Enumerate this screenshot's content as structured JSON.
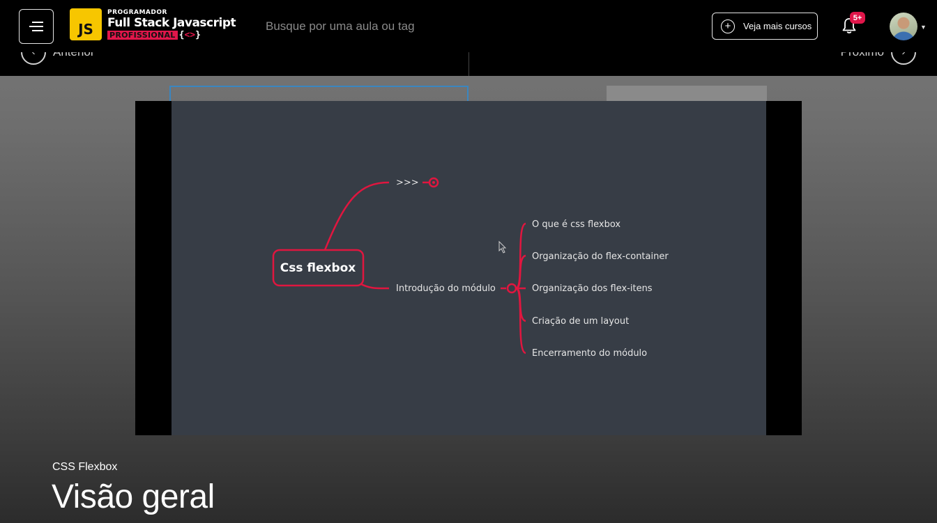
{
  "header": {
    "logo": {
      "badge": "JS",
      "line1": "PROGRAMADOR",
      "line2": "Full Stack Javascript",
      "line3": "PROFISSIONAL",
      "brace_left": "{",
      "brace_mid": "<>",
      "brace_right": "}"
    },
    "search_placeholder": "Busque por uma aula ou tag",
    "courses_button": "Veja mais cursos",
    "notification_badge": "5+"
  },
  "nav": {
    "prev_label": "Anterior",
    "next_label": "Próximo"
  },
  "slide": {
    "center": "Css flexbox",
    "top_branch": ">>>",
    "mid_branch": "Introdução do módulo",
    "items": [
      "O que é css flexbox",
      "Organização do flex-container",
      "Organização dos flex-itens",
      "Criação de um layout",
      "Encerramento do módulo"
    ],
    "colors": {
      "accent": "#e0163f",
      "background": "#373d46"
    }
  },
  "lesson": {
    "module": "CSS Flexbox",
    "title": "Visão geral"
  },
  "icons": [
    "menu-icon",
    "plus-icon",
    "bell-icon",
    "chevron-left-icon",
    "chevron-right-icon",
    "chevron-down-icon"
  ]
}
